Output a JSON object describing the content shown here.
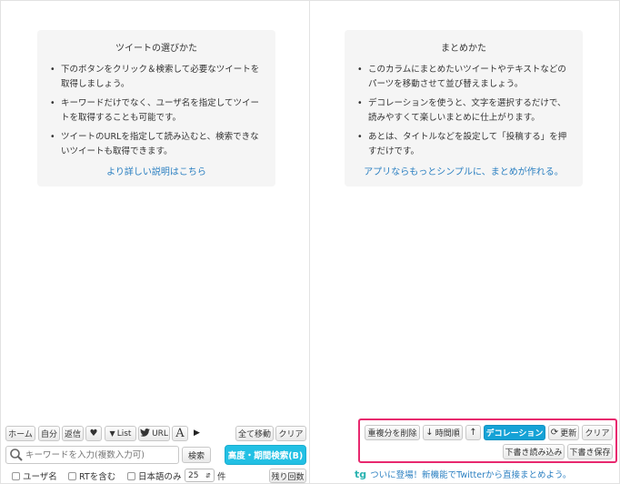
{
  "left_help": {
    "title": "ツイートの選びかた",
    "items": [
      "下のボタンをクリック＆検索して必要なツイートを取得しましょう。",
      "キーワードだけでなく、ユーザ名を指定してツイートを取得することも可能です。",
      "ツイートのURLを指定して読み込むと、検索できないツイートも取得できます。"
    ],
    "link": "より詳しい説明はこちら"
  },
  "right_help": {
    "title": "まとめかた",
    "items": [
      "このカラムにまとめたいツイートやテキストなどのパーツを移動させて並び替えましょう。",
      "デコレーションを使うと、文字を選択するだけで、読みやすくて楽しいまとめに仕上がります。",
      "あとは、タイトルなどを設定して「投稿する」を押すだけです。"
    ],
    "link": "アプリならもっとシンプルに、まとめが作れる。"
  },
  "left_toolbar": {
    "home": "ホーム",
    "self": "自分",
    "reply": "返信",
    "heart_icon": "heart-icon",
    "list": "List",
    "url": "URL",
    "font_icon": "A",
    "more_icon": "▶",
    "move_all": "全て移動",
    "clear": "クリア"
  },
  "search": {
    "placeholder": "キーワードを入力(複数入力可)",
    "button": "検索",
    "advanced": "高度・期間検索(B)"
  },
  "options": {
    "username": "ユーザ名",
    "rt": "RTを含む",
    "japanese_only": "日本語のみ",
    "count_value": "25",
    "count_unit": "件",
    "remaining": "残り回数"
  },
  "right_toolbar": {
    "dedupe": "重複分を削除",
    "chronological": "時間順",
    "decoration": "デコレーション",
    "refresh": "更新",
    "clear": "クリア",
    "load_draft": "下書き読み込み",
    "save_draft": "下書き保存"
  },
  "promo": {
    "logo": "tg",
    "text": "ついに登場！新機能でTwitterから直接まとめよう。"
  },
  "colors": {
    "accent_blue": "#15a2d6",
    "accent_cyan": "#22c0e4",
    "highlight_pink": "#e8286e",
    "link_blue": "#2a7fc1"
  }
}
